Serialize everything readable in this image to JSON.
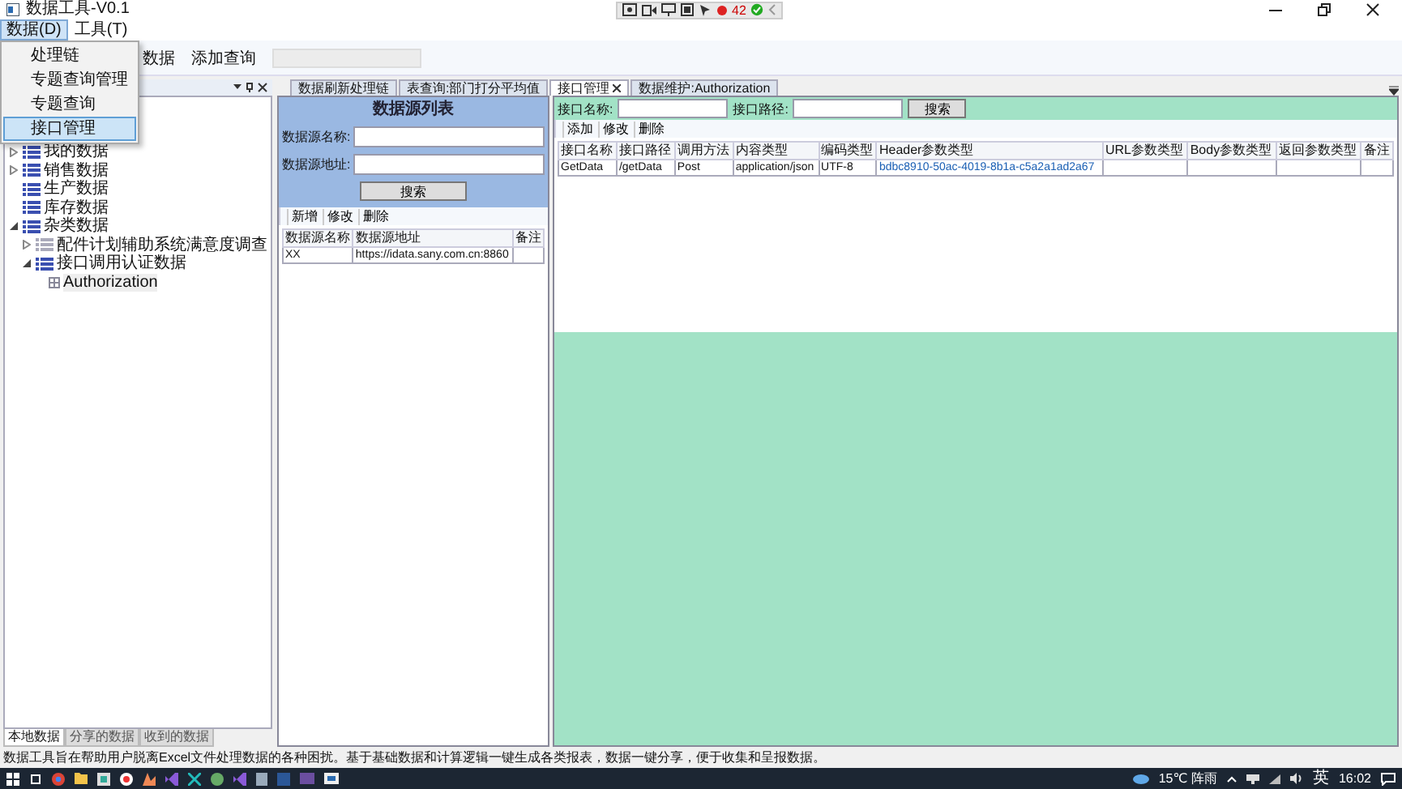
{
  "window": {
    "title": "数据工具-V0.1",
    "counter": "42"
  },
  "menu": [
    {
      "label": "数据(D)",
      "selected": true
    },
    {
      "label": "工具(T)",
      "selected": false
    }
  ],
  "dropdown": [
    {
      "label": "处理链",
      "selected": false
    },
    {
      "label": "专题查询管理",
      "selected": false
    },
    {
      "label": "专题查询",
      "selected": false
    },
    {
      "label": "接口管理",
      "selected": true
    }
  ],
  "ribbon": {
    "group_label": "数据",
    "query_label": "添加查询"
  },
  "tree": [
    {
      "label": "我的数据",
      "expanded": false,
      "selected": false
    },
    {
      "label": "销售数据",
      "expanded": false,
      "selected": false
    },
    {
      "label": "生产数据",
      "selected": false
    },
    {
      "label": "库存数据",
      "selected": false
    },
    {
      "label": "杂类数据",
      "expanded": true,
      "selected": false,
      "children": [
        {
          "label": "配件计划辅助系统满意度调查",
          "expanded": false,
          "selected": false
        },
        {
          "label": "接口调用认证数据",
          "expanded": true,
          "selected": false,
          "children": [
            {
              "label": "Authorization",
              "selected": true
            }
          ]
        }
      ]
    }
  ],
  "left_tabs": [
    {
      "label": "本地数据",
      "selected": true
    },
    {
      "label": "分享的数据",
      "selected": false
    },
    {
      "label": "收到的数据",
      "selected": false
    }
  ],
  "doc_tabs": [
    {
      "label": "数据刷新处理链",
      "selected": false,
      "closable": false
    },
    {
      "label": "表查询:部门打分平均值",
      "selected": false,
      "closable": false
    },
    {
      "label": "接口管理",
      "selected": true,
      "closable": true
    },
    {
      "label": "数据维护:Authorization",
      "selected": false,
      "closable": false
    }
  ],
  "source_panel": {
    "title": "数据源列表",
    "fields": [
      {
        "label": "数据源名称:"
      },
      {
        "label": "数据源地址:"
      }
    ],
    "search_button": "搜索",
    "toolbar": [
      "新增",
      "修改",
      "删除"
    ],
    "columns": [
      "数据源名称",
      "数据源地址",
      "备注"
    ],
    "rows": [
      [
        "XX",
        "https://idata.sany.com.cn:8860"
      ]
    ]
  },
  "api_panel": {
    "fields": [
      {
        "label": "接口名称:"
      },
      {
        "label": "接口路径:"
      }
    ],
    "search_button": "搜索",
    "toolbar": [
      "添加",
      "修改",
      "删除"
    ],
    "columns": [
      "接口名称",
      "接口路径",
      "调用方法",
      "内容类型",
      "编码类型",
      "Header参数类型",
      "URL参数类型",
      "Body参数类型",
      "返回参数类型",
      "备注"
    ],
    "rows": [
      [
        {
          "text": "GetData",
          "kind": "text"
        },
        {
          "text": "/getData",
          "kind": "text"
        },
        {
          "text": "Post",
          "kind": "text"
        },
        {
          "text": "application/json",
          "kind": "text"
        },
        {
          "text": "UTF-8",
          "kind": "text"
        },
        {
          "text": "bdbc8910-50ac-4019-8b1a-c5a2a1ad2a67",
          "kind": "link"
        }
      ]
    ]
  },
  "status_bar": "数据工具旨在帮助用户脱离Excel文件处理数据的各种困扰。基于基础数据和计算逻辑一键生成各类报表，数据一键分享，便于收集和呈报数据。",
  "taskbar": {
    "weather": "15℃ 阵雨",
    "ime": "英",
    "time": "16:02"
  }
}
